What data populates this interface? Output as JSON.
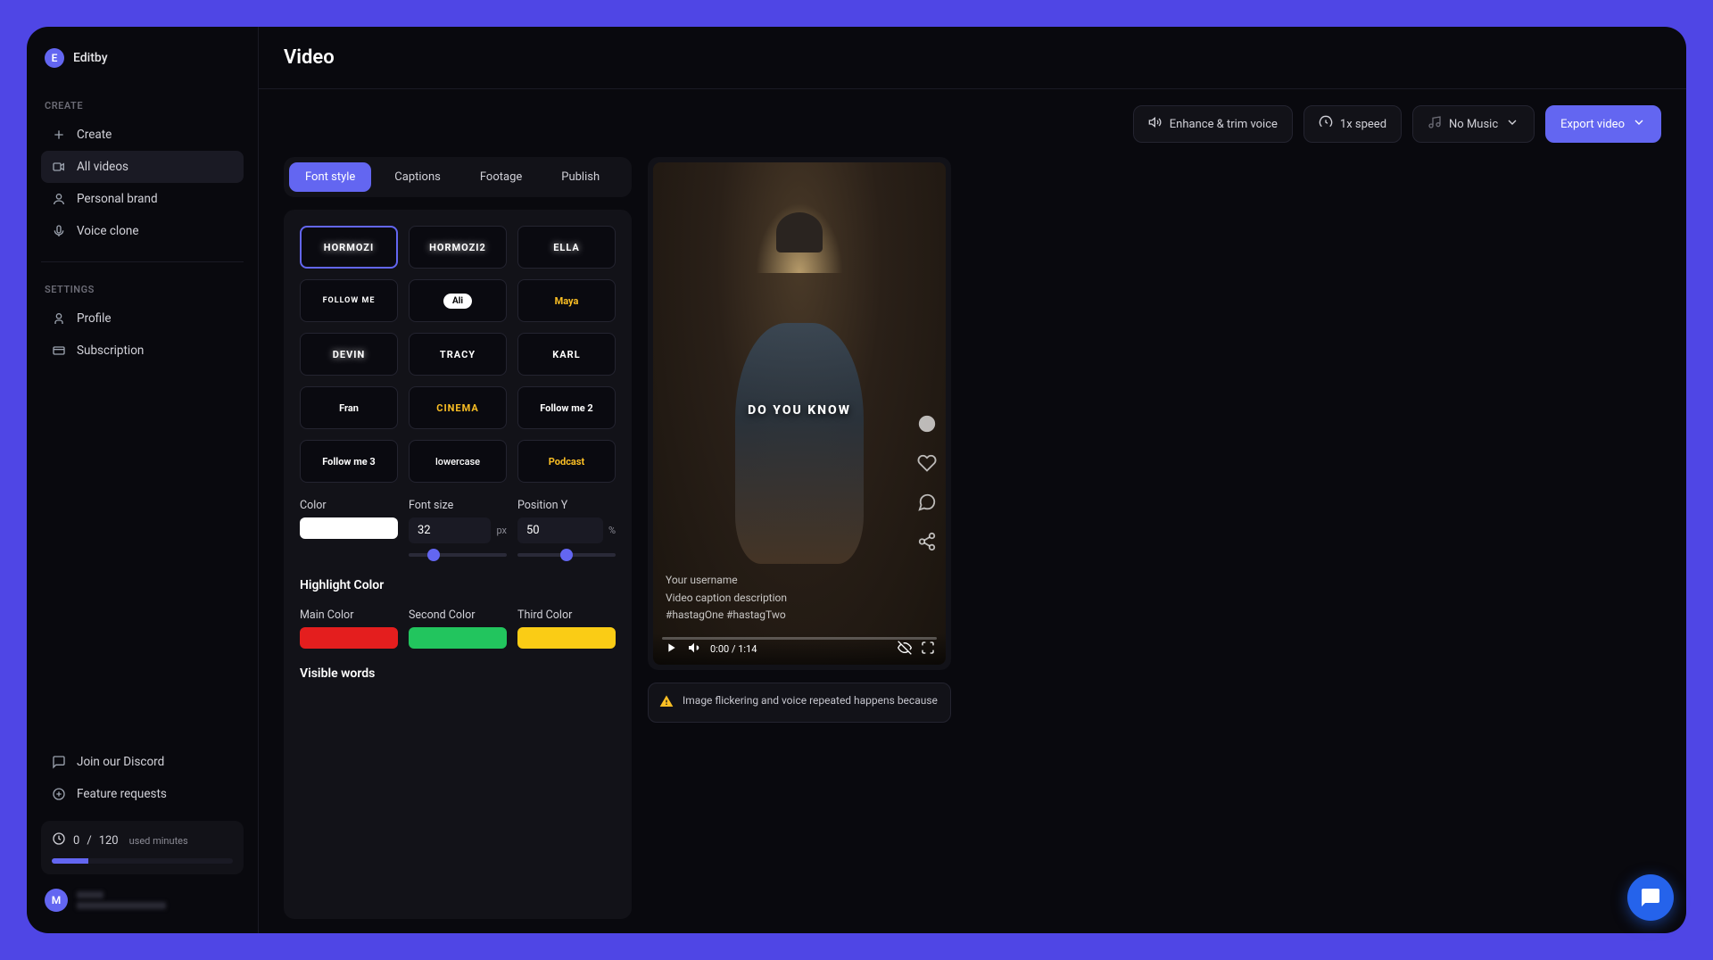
{
  "app": {
    "name": "Editby",
    "logo_initial": "E"
  },
  "sidebar": {
    "create_label": "CREATE",
    "settings_label": "SETTINGS",
    "items_create": [
      {
        "label": "Create"
      },
      {
        "label": "All videos"
      },
      {
        "label": "Personal brand"
      },
      {
        "label": "Voice clone"
      }
    ],
    "items_settings": [
      {
        "label": "Profile"
      },
      {
        "label": "Subscription"
      }
    ],
    "footer": [
      {
        "label": "Join our Discord"
      },
      {
        "label": "Feature requests"
      }
    ],
    "usage": {
      "used": "0",
      "sep": "/",
      "total": "120",
      "label": "used minutes"
    },
    "user_initial": "M"
  },
  "header": {
    "title": "Video"
  },
  "toolbar": {
    "enhance": "Enhance & trim voice",
    "speed": "1x speed",
    "music": "No Music",
    "export": "Export video"
  },
  "tabs": [
    {
      "label": "Font style",
      "active": true
    },
    {
      "label": "Captions"
    },
    {
      "label": "Footage"
    },
    {
      "label": "Publish"
    }
  ],
  "styles": [
    {
      "name": "HORMOZI",
      "selected": true,
      "cls": "style-upper style-glow"
    },
    {
      "name": "HORMOZI2",
      "cls": "style-upper style-glow"
    },
    {
      "name": "ELLA",
      "cls": "style-upper style-glow"
    },
    {
      "name": "FOLLOW ME",
      "cls": "style-upper style-fm"
    },
    {
      "name": "Ali",
      "cls": "style-pill"
    },
    {
      "name": "Maya",
      "cls": "style-yellow"
    },
    {
      "name": "DEVIN",
      "cls": "style-upper style-glow"
    },
    {
      "name": "TRACY",
      "cls": "style-upper"
    },
    {
      "name": "KARL",
      "cls": "style-upper"
    },
    {
      "name": "Fran",
      "cls": ""
    },
    {
      "name": "CINEMA",
      "cls": "style-yellow style-upper"
    },
    {
      "name": "Follow me 2",
      "cls": ""
    },
    {
      "name": "Follow me 3",
      "cls": ""
    },
    {
      "name": "lowercase",
      "cls": "style-lower"
    },
    {
      "name": "Podcast",
      "cls": "style-yellow"
    }
  ],
  "controls": {
    "color_label": "Color",
    "color_value": "#ffffff",
    "fontsize_label": "Font size",
    "fontsize_value": "32",
    "fontsize_unit": "px",
    "posy_label": "Position Y",
    "posy_value": "50",
    "posy_unit": "%"
  },
  "highlight": {
    "title": "Highlight Color",
    "main_label": "Main Color",
    "main_value": "#e41e1e",
    "second_label": "Second Color",
    "second_value": "#22c55e",
    "third_label": "Third Color",
    "third_value": "#facc15"
  },
  "visible_words_title": "Visible words",
  "preview": {
    "caption": "DO YOU KNOW",
    "username": "Your username",
    "description": "Video caption description",
    "hashtags": "#hastagOne #hastagTwo",
    "time": "0:00 / 1:14"
  },
  "warning": "Image flickering and voice repeated happens because"
}
